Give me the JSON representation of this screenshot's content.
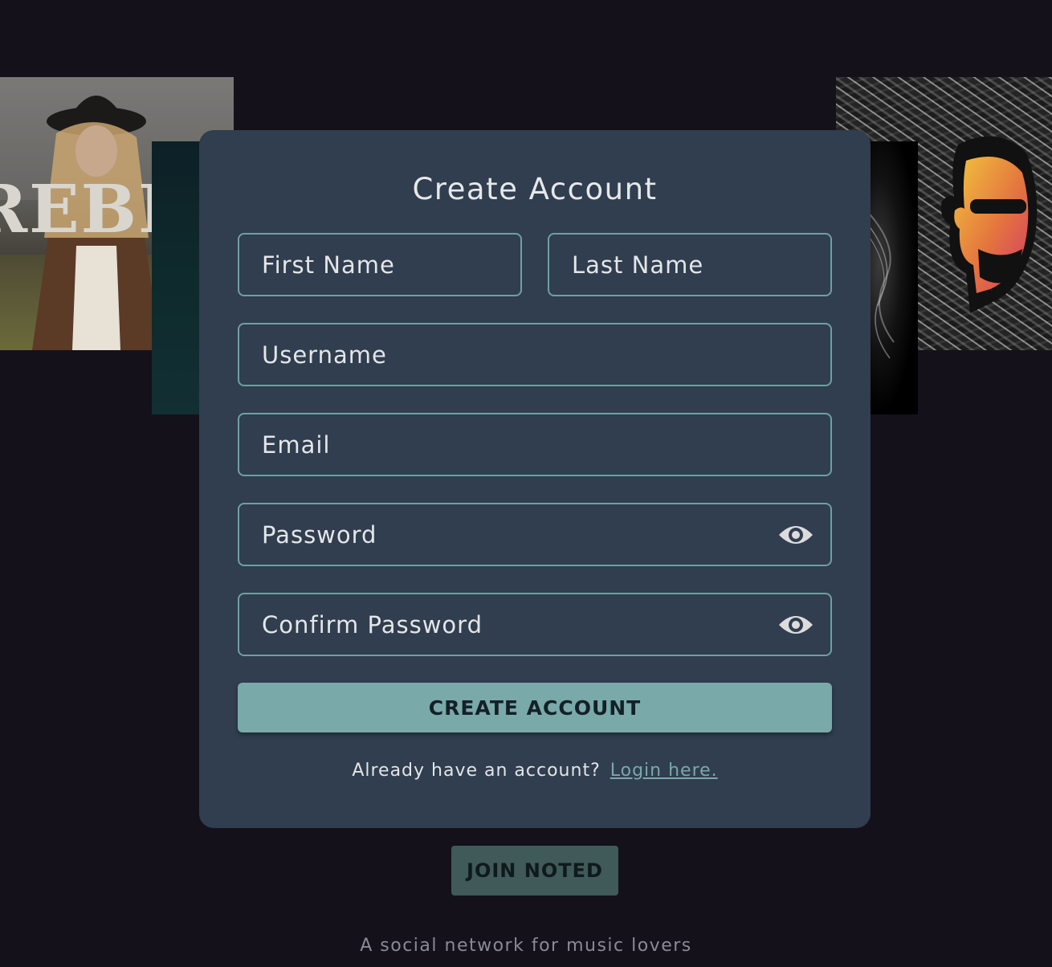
{
  "background_art": {
    "left_cover_text": "REBE"
  },
  "form": {
    "title": "Create Account",
    "fields": {
      "first_name": "First Name",
      "last_name": "Last Name",
      "username": "Username",
      "email": "Email",
      "password": "Password",
      "confirm_password": "Confirm Password"
    },
    "submit_label": "CREATE ACCOUNT",
    "login_prompt": "Already have an account?",
    "login_link": "Login here."
  },
  "join_button_label": "JOIN NOTED",
  "tagline": "A social network for music lovers",
  "colors": {
    "background": "#14111b",
    "card": "#303e4f",
    "accent": "#79a9a9",
    "field_border": "#6fa0a2",
    "join_button": "#3f5a58"
  },
  "icons": {
    "password_toggle": "eye-icon",
    "confirm_password_toggle": "eye-icon"
  }
}
